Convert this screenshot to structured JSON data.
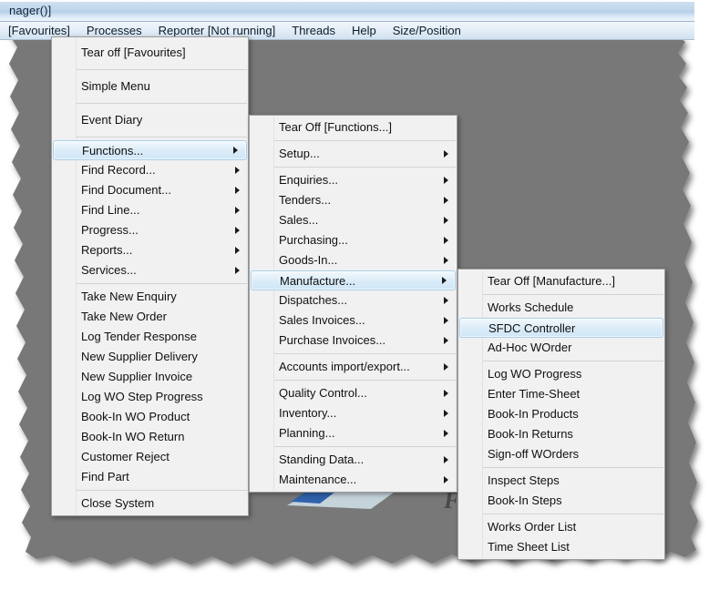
{
  "window": {
    "title": "nager()]"
  },
  "menubar": {
    "items": [
      {
        "label": "[Favourites]",
        "name": "menubar-favourites"
      },
      {
        "label": "Processes",
        "name": "menubar-processes"
      },
      {
        "label": "Reporter [Not running]",
        "name": "menubar-reporter"
      },
      {
        "label": "Threads",
        "name": "menubar-threads"
      },
      {
        "label": "Help",
        "name": "menubar-help"
      },
      {
        "label": "Size/Position",
        "name": "menubar-size-position"
      }
    ]
  },
  "background": {
    "watermark_text": "FC"
  },
  "menus": {
    "favourites": {
      "title": "[Favourites]",
      "items": [
        {
          "label": "Tear off [Favourites]",
          "submenu": false,
          "selected": false,
          "separator_after": true,
          "tall": true
        },
        {
          "label": "Simple Menu",
          "submenu": false,
          "selected": false,
          "separator_after": true,
          "tall": true
        },
        {
          "label": "Event Diary",
          "submenu": false,
          "selected": false,
          "separator_after": true,
          "tall": true
        },
        {
          "label": "Functions...",
          "submenu": true,
          "selected": true,
          "separator_after": false
        },
        {
          "label": "Find Record...",
          "submenu": true,
          "selected": false,
          "separator_after": false
        },
        {
          "label": "Find Document...",
          "submenu": true,
          "selected": false,
          "separator_after": false
        },
        {
          "label": "Find Line...",
          "submenu": true,
          "selected": false,
          "separator_after": false
        },
        {
          "label": "Progress...",
          "submenu": true,
          "selected": false,
          "separator_after": false
        },
        {
          "label": "Reports...",
          "submenu": true,
          "selected": false,
          "separator_after": false
        },
        {
          "label": "Services...",
          "submenu": true,
          "selected": false,
          "separator_after": true
        },
        {
          "label": "Take New Enquiry",
          "submenu": false,
          "selected": false,
          "separator_after": false
        },
        {
          "label": "Take New Order",
          "submenu": false,
          "selected": false,
          "separator_after": false
        },
        {
          "label": "Log Tender Response",
          "submenu": false,
          "selected": false,
          "separator_after": false
        },
        {
          "label": "New Supplier Delivery",
          "submenu": false,
          "selected": false,
          "separator_after": false
        },
        {
          "label": "New Supplier Invoice",
          "submenu": false,
          "selected": false,
          "separator_after": false
        },
        {
          "label": "Log WO Step Progress",
          "submenu": false,
          "selected": false,
          "separator_after": false
        },
        {
          "label": "Book-In WO Product",
          "submenu": false,
          "selected": false,
          "separator_after": false
        },
        {
          "label": "Book-In WO Return",
          "submenu": false,
          "selected": false,
          "separator_after": false
        },
        {
          "label": "Customer Reject",
          "submenu": false,
          "selected": false,
          "separator_after": false
        },
        {
          "label": "Find Part",
          "submenu": false,
          "selected": false,
          "separator_after": true
        },
        {
          "label": "Close System",
          "submenu": false,
          "selected": false,
          "separator_after": false
        }
      ]
    },
    "functions": {
      "title": "[Functions...]",
      "items": [
        {
          "label": "Tear Off [Functions...]",
          "submenu": false,
          "selected": false,
          "separator_after": true
        },
        {
          "label": "Setup...",
          "submenu": true,
          "selected": false,
          "separator_after": true
        },
        {
          "label": "Enquiries...",
          "submenu": true,
          "selected": false,
          "separator_after": false
        },
        {
          "label": "Tenders...",
          "submenu": true,
          "selected": false,
          "separator_after": false
        },
        {
          "label": "Sales...",
          "submenu": true,
          "selected": false,
          "separator_after": false
        },
        {
          "label": "Purchasing...",
          "submenu": true,
          "selected": false,
          "separator_after": false
        },
        {
          "label": "Goods-In...",
          "submenu": true,
          "selected": false,
          "separator_after": false
        },
        {
          "label": "Manufacture...",
          "submenu": true,
          "selected": true,
          "separator_after": false
        },
        {
          "label": "Dispatches...",
          "submenu": true,
          "selected": false,
          "separator_after": false
        },
        {
          "label": "Sales Invoices...",
          "submenu": true,
          "selected": false,
          "separator_after": false
        },
        {
          "label": "Purchase Invoices...",
          "submenu": true,
          "selected": false,
          "separator_after": true
        },
        {
          "label": "Accounts import/export...",
          "submenu": true,
          "selected": false,
          "separator_after": true
        },
        {
          "label": "Quality Control...",
          "submenu": true,
          "selected": false,
          "separator_after": false
        },
        {
          "label": "Inventory...",
          "submenu": true,
          "selected": false,
          "separator_after": false
        },
        {
          "label": "Planning...",
          "submenu": true,
          "selected": false,
          "separator_after": true
        },
        {
          "label": "Standing Data...",
          "submenu": true,
          "selected": false,
          "separator_after": false
        },
        {
          "label": "Maintenance...",
          "submenu": true,
          "selected": false,
          "separator_after": false
        }
      ]
    },
    "manufacture": {
      "title": "[Manufacture...]",
      "items": [
        {
          "label": "Tear Off [Manufacture...]",
          "submenu": false,
          "selected": false,
          "separator_after": true
        },
        {
          "label": "Works Schedule",
          "submenu": false,
          "selected": false,
          "separator_after": false
        },
        {
          "label": "SFDC Controller",
          "submenu": false,
          "selected": true,
          "separator_after": false
        },
        {
          "label": "Ad-Hoc WOrder",
          "submenu": false,
          "selected": false,
          "separator_after": true
        },
        {
          "label": "Log WO Progress",
          "submenu": false,
          "selected": false,
          "separator_after": false
        },
        {
          "label": "Enter Time-Sheet",
          "submenu": false,
          "selected": false,
          "separator_after": false
        },
        {
          "label": "Book-In Products",
          "submenu": false,
          "selected": false,
          "separator_after": false
        },
        {
          "label": "Book-In Returns",
          "submenu": false,
          "selected": false,
          "separator_after": false
        },
        {
          "label": "Sign-off WOrders",
          "submenu": false,
          "selected": false,
          "separator_after": true
        },
        {
          "label": "Inspect Steps",
          "submenu": false,
          "selected": false,
          "separator_after": false
        },
        {
          "label": "Book-In Steps",
          "submenu": false,
          "selected": false,
          "separator_after": true
        },
        {
          "label": "Works Order List",
          "submenu": false,
          "selected": false,
          "separator_after": false
        },
        {
          "label": "Time Sheet List",
          "submenu": false,
          "selected": false,
          "separator_after": false
        }
      ]
    }
  },
  "colors": {
    "selection_border": "#a8cfe8",
    "selection_fill": "#dcecf8",
    "menu_background": "#f1f1f1",
    "desktop": "#787878",
    "titlebar": "#bed5ec"
  }
}
